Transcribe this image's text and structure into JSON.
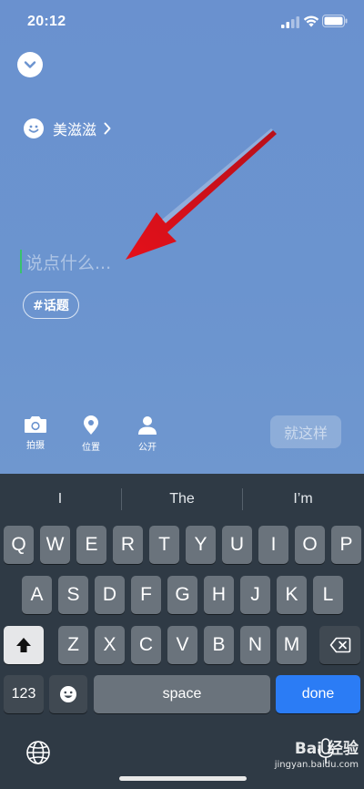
{
  "status_bar": {
    "time": "20:12"
  },
  "profile": {
    "name": "美滋滋"
  },
  "compose": {
    "placeholder": "说点什么..."
  },
  "topic": {
    "label": "#话题"
  },
  "toolbar": {
    "camera_label": "拍摄",
    "location_label": "位置",
    "privacy_label": "公开",
    "submit_label": "就这样"
  },
  "keyboard": {
    "suggestions": [
      "I",
      "The",
      "I’m"
    ],
    "row1": [
      "Q",
      "W",
      "E",
      "R",
      "T",
      "Y",
      "U",
      "I",
      "O",
      "P"
    ],
    "row2": [
      "A",
      "S",
      "D",
      "F",
      "G",
      "H",
      "J",
      "K",
      "L"
    ],
    "row3": [
      "Z",
      "X",
      "C",
      "V",
      "B",
      "N",
      "M"
    ],
    "numbers_label": "123",
    "space_label": "space",
    "done_label": "done"
  },
  "watermark": {
    "brand": "Bai 经验",
    "url": "jingyan.baidu.com"
  },
  "colors": {
    "background": "#6b93cf",
    "keyboard": "#2f3a45",
    "done_key": "#2b7cf5",
    "annotation": "#e8141a",
    "cursor": "#38c26d"
  }
}
